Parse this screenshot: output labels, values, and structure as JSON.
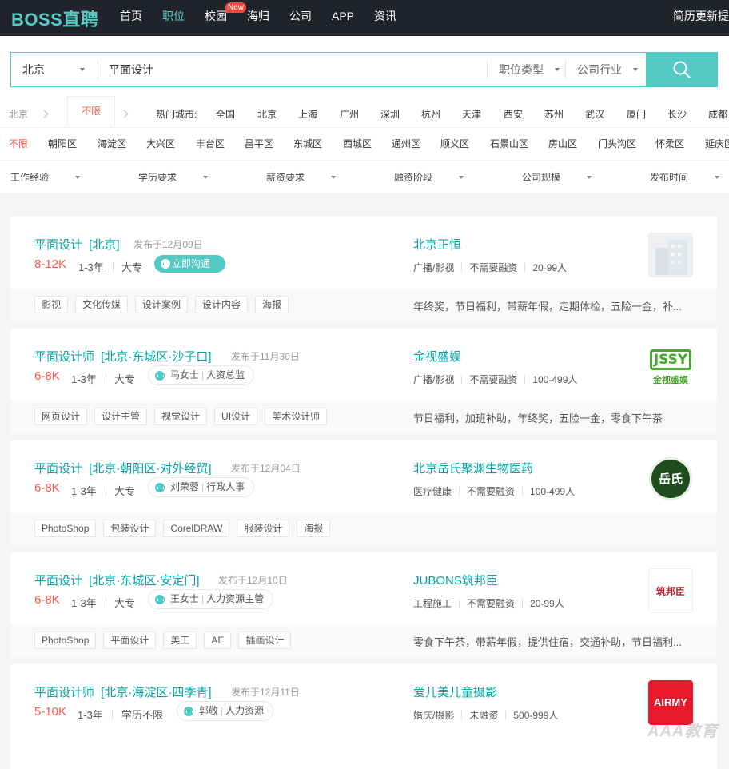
{
  "topbar": {
    "logo": "BOSS直聘",
    "nav": [
      "首页",
      "职位",
      "校园",
      "海归",
      "公司",
      "APP",
      "资讯"
    ],
    "new_badge": "New",
    "right_link": "简历更新提"
  },
  "search": {
    "city": "北京",
    "query": "平面设计",
    "job_type": "职位类型",
    "industry": "公司行业"
  },
  "city_filter": {
    "current": "北京",
    "unlimited": "不限",
    "hot_label": "热门城市:",
    "cities": [
      "全国",
      "北京",
      "上海",
      "广州",
      "深圳",
      "杭州",
      "天津",
      "西安",
      "苏州",
      "武汉",
      "厦门",
      "长沙",
      "成都"
    ]
  },
  "district_filter": {
    "unlimited": "不限",
    "districts": [
      "朝阳区",
      "海淀区",
      "大兴区",
      "丰台区",
      "昌平区",
      "东城区",
      "西城区",
      "通州区",
      "顺义区",
      "石景山区",
      "房山区",
      "门头沟区",
      "怀柔区",
      "延庆区"
    ]
  },
  "filters": [
    "工作经验",
    "学历要求",
    "薪资要求",
    "融资阶段",
    "公司规模",
    "发布时间"
  ],
  "jobs": [
    {
      "title": "平面设计",
      "location": "[北京]",
      "published": "发布于12月09日",
      "salary": "8-12K",
      "experience": "1-3年",
      "education": "大专",
      "chat_label": "立即沟通",
      "company": "北京正恒",
      "industry": "广播/影视",
      "funding": "不需要融资",
      "size": "20-99人",
      "tags": [
        "影视",
        "文化传媒",
        "设计案例",
        "设计内容",
        "海报"
      ],
      "welfare": "年终奖，节日福利，带薪年假，定期体检，五险一金，补..."
    },
    {
      "title": "平面设计师",
      "location": "[北京·东城区·沙子口]",
      "published": "发布于11月30日",
      "salary": "6-8K",
      "experience": "1-3年",
      "education": "大专",
      "hr_name": "马女士",
      "hr_title": "人资总监",
      "company": "金视盛娱",
      "industry": "广播/影视",
      "funding": "不需要融资",
      "size": "100-499人",
      "logo_text": "JSSY",
      "logo_sub": "金视盛娱",
      "tags": [
        "网页设计",
        "设计主管",
        "视觉设计",
        "UI设计",
        "美术设计师"
      ],
      "welfare": "节日福利，加班补助，年终奖，五险一金，零食下午茶"
    },
    {
      "title": "平面设计",
      "location": "[北京·朝阳区·对外经贸]",
      "published": "发布于12月04日",
      "salary": "6-8K",
      "experience": "1-3年",
      "education": "大专",
      "hr_name": "刘荣蓉",
      "hr_title": "行政人事",
      "company": "北京岳氏聚渊生物医药",
      "industry": "医疗健康",
      "funding": "不需要融资",
      "size": "100-499人",
      "logo_text": "岳氏",
      "tags": [
        "PhotoShop",
        "包装设计",
        "CorelDRAW",
        "服装设计",
        "海报"
      ],
      "welfare": ""
    },
    {
      "title": "平面设计",
      "location": "[北京·东城区·安定门]",
      "published": "发布于12月10日",
      "salary": "6-8K",
      "experience": "1-3年",
      "education": "大专",
      "hr_name": "王女士",
      "hr_title": "人力资源主管",
      "company": "JUBONS筑邦臣",
      "industry": "工程施工",
      "funding": "不需要融资",
      "size": "20-99人",
      "logo_text": "筑邦臣",
      "tags": [
        "PhotoShop",
        "平面设计",
        "美工",
        "AE",
        "插画设计"
      ],
      "welfare": "零食下午茶，带薪年假，提供住宿，交通补助，节日福利..."
    },
    {
      "title": "平面设计师",
      "location": "[北京·海淀区·四季青]",
      "published": "发布于12月11日",
      "salary": "5-10K",
      "experience": "1-3年",
      "education": "学历不限",
      "hr_name": "郭敬",
      "hr_title": "人力资源",
      "company": "爱儿美儿童摄影",
      "industry": "婚庆/摄影",
      "funding": "未融资",
      "size": "500-999人",
      "logo_text": "AIRMY",
      "tags": [],
      "welfare": ""
    }
  ],
  "watermark": "AAA教育",
  "colors": {
    "brand": "#53cac3",
    "salary": "#fe574a",
    "link": "#00a6a7",
    "topbar": "#202329"
  }
}
